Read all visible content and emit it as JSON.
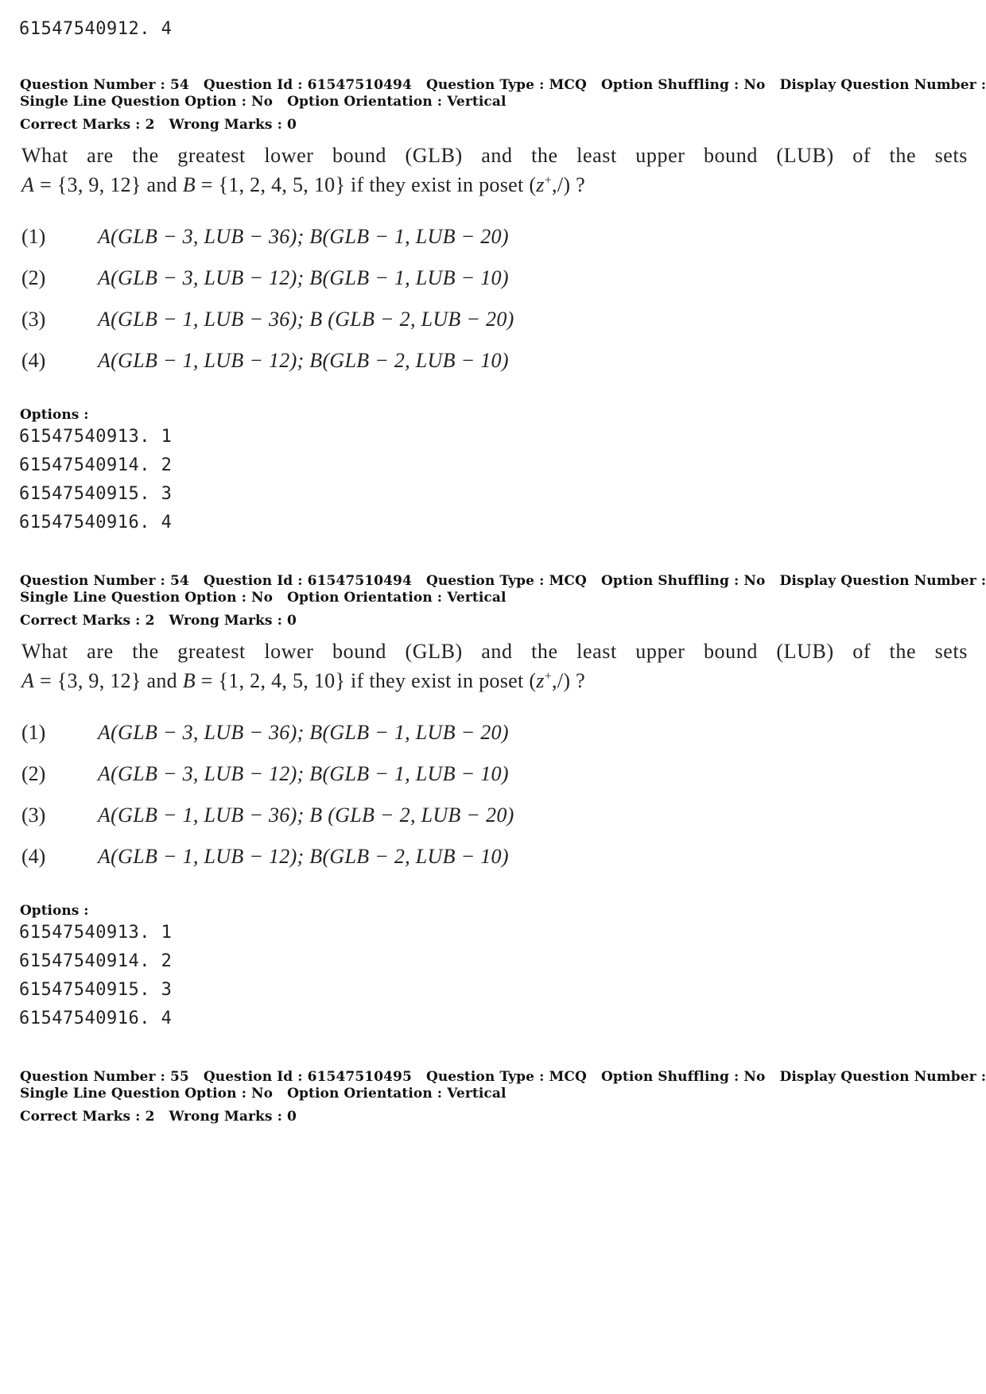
{
  "top_option_line": "61547540912. 4",
  "questions": [
    {
      "meta": {
        "question_number": "Question Number : 54",
        "question_id": "Question Id : 61547510494",
        "question_type": "Question Type : MCQ",
        "option_shuffling": "Option Shuffling : No",
        "display_question_number": "Display Question Number : Yes",
        "single_line": "Single Line Question Option : No",
        "orientation": "Option Orientation : Vertical",
        "correct_marks": "Correct Marks : 2",
        "wrong_marks": "Wrong Marks : 0"
      },
      "text_line1": "What are the greatest lower bound (GLB) and the least upper bound (LUB) of the sets",
      "text_line2_a": "A",
      "text_line2_b": " = {3, 9, 12}  and  ",
      "text_line2_c": "B",
      "text_line2_d": " = {1, 2, 4, 5, 10}  if they exist in poset (",
      "text_line2_e": "z",
      "text_line2_f": "+",
      "text_line2_g": ",/) ?",
      "choices": [
        {
          "num": "(1)",
          "text": "A(GLB − 3, LUB − 36); B(GLB − 1, LUB − 20)"
        },
        {
          "num": "(2)",
          "text": "A(GLB − 3, LUB − 12); B(GLB − 1, LUB − 10)"
        },
        {
          "num": "(3)",
          "text": "A(GLB − 1, LUB − 36); B (GLB − 2, LUB − 20)"
        },
        {
          "num": "(4)",
          "text": "A(GLB − 1, LUB − 12); B(GLB − 2, LUB − 10)"
        }
      ],
      "options_label": "Options :",
      "option_ids": [
        "61547540913. 1",
        "61547540914. 2",
        "61547540915. 3",
        "61547540916. 4"
      ]
    },
    {
      "meta": {
        "question_number": "Question Number : 54",
        "question_id": "Question Id : 61547510494",
        "question_type": "Question Type : MCQ",
        "option_shuffling": "Option Shuffling : No",
        "display_question_number": "Display Question Number : Yes",
        "single_line": "Single Line Question Option : No",
        "orientation": "Option Orientation : Vertical",
        "correct_marks": "Correct Marks : 2",
        "wrong_marks": "Wrong Marks : 0"
      },
      "text_line1": "What are the greatest lower bound (GLB) and the least upper bound (LUB) of the sets",
      "text_line2_a": "A",
      "text_line2_b": " = {3, 9, 12}  and  ",
      "text_line2_c": "B",
      "text_line2_d": " = {1, 2, 4, 5, 10}  if they exist in poset (",
      "text_line2_e": "z",
      "text_line2_f": "+",
      "text_line2_g": ",/) ?",
      "choices": [
        {
          "num": "(1)",
          "text": "A(GLB − 3, LUB − 36); B(GLB − 1, LUB − 20)"
        },
        {
          "num": "(2)",
          "text": "A(GLB − 3, LUB − 12); B(GLB − 1, LUB − 10)"
        },
        {
          "num": "(3)",
          "text": "A(GLB − 1, LUB − 36); B (GLB − 2, LUB − 20)"
        },
        {
          "num": "(4)",
          "text": "A(GLB − 1, LUB − 12); B(GLB − 2, LUB − 10)"
        }
      ],
      "options_label": "Options :",
      "option_ids": [
        "61547540913. 1",
        "61547540914. 2",
        "61547540915. 3",
        "61547540916. 4"
      ]
    },
    {
      "meta": {
        "question_number": "Question Number : 55",
        "question_id": "Question Id : 61547510495",
        "question_type": "Question Type : MCQ",
        "option_shuffling": "Option Shuffling : No",
        "display_question_number": "Display Question Number : Yes",
        "single_line": "Single Line Question Option : No",
        "orientation": "Option Orientation : Vertical",
        "correct_marks": "Correct Marks : 2",
        "wrong_marks": "Wrong Marks : 0"
      }
    }
  ]
}
